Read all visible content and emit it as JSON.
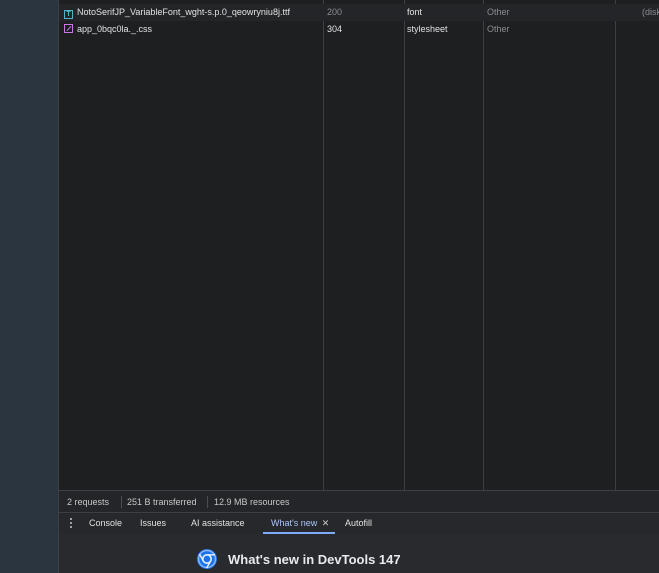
{
  "requests": [
    {
      "name": "NotoSerifJP_VariableFont_wght-s.p.0_qeowryniu8j.ttf",
      "status": "200",
      "type": "font",
      "initiator": "Other",
      "size": "(disk",
      "icon": "font-file-icon"
    },
    {
      "name": "app_0bqc0la._.css",
      "status": "304",
      "type": "stylesheet",
      "initiator": "Other",
      "size": "",
      "icon": "stylesheet-file-icon"
    }
  ],
  "status_bar": {
    "requests": "2 requests",
    "transferred": "251 B transferred",
    "resources": "12.9 MB resources"
  },
  "drawer": {
    "tabs": [
      {
        "label": "Console"
      },
      {
        "label": "Issues"
      },
      {
        "label": "AI assistance"
      },
      {
        "label": "What's new",
        "active": true
      },
      {
        "label": "Autofill"
      }
    ],
    "close_glyph": "✕",
    "whats_new_title": "What's new in DevTools 147"
  },
  "colors": {
    "accent": "#7cacf8",
    "font_icon": "#4fb3c9",
    "css_icon": "#c77bde"
  }
}
